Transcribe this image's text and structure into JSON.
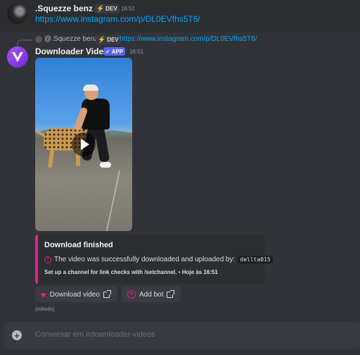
{
  "message1": {
    "username": ".Squezze benz",
    "badge": "DEV",
    "timestamp": "16:51",
    "link": "https://www.instagram.com/p/DL0EVfhs5T6/"
  },
  "reply": {
    "username": "@.Squezze benz",
    "badge": "DEV",
    "link": "https://www.instagram.com/p/DL0EVfhs5T6/"
  },
  "message2": {
    "username": "Downloader Videos",
    "app_badge": "APP",
    "timestamp": "16:51",
    "embed": {
      "title": "Download finished",
      "description": "The video was successfully downloaded and uploaded by:",
      "uploader": "dellta015",
      "footer": "Set up a channel for link checks with /setchannel. • Hoje às 16:51"
    },
    "buttons": {
      "download": "Download video",
      "add_bot": "Add bot"
    },
    "edited": "(editado)"
  },
  "composer": {
    "placeholder": "Conversar em #downloader-videos"
  },
  "colors": {
    "accent": "#e91e8c",
    "link": "#00a8fc",
    "app_badge": "#5865f2"
  }
}
